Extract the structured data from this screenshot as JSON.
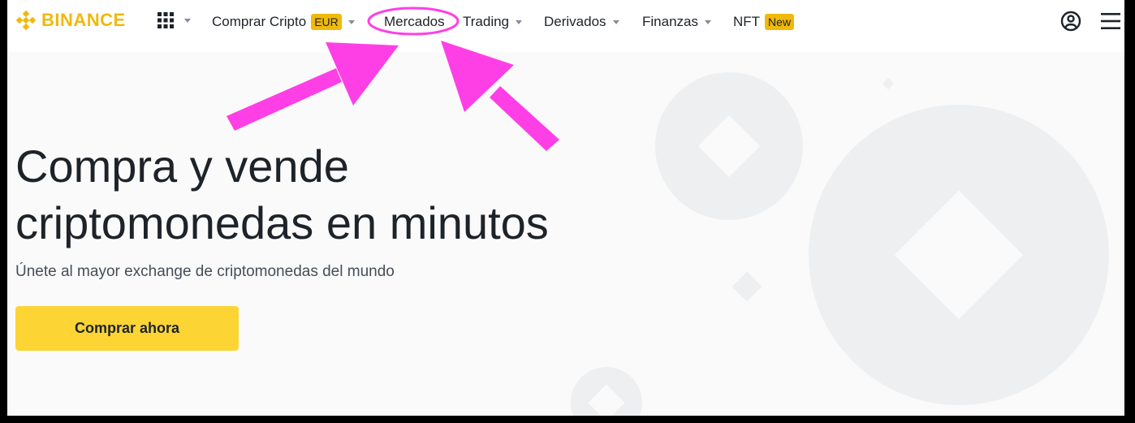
{
  "brand": {
    "name": "BINANCE",
    "color": "#F0B90B"
  },
  "nav": {
    "items": [
      {
        "label": "Comprar Cripto",
        "badge": "EUR",
        "has_caret": true
      },
      {
        "label": "Mercados",
        "badge": "",
        "has_caret": false
      },
      {
        "label": "Trading",
        "badge": "",
        "has_caret": true
      },
      {
        "label": "Derivados",
        "badge": "",
        "has_caret": true
      },
      {
        "label": "Finanzas",
        "badge": "",
        "has_caret": true
      },
      {
        "label": "NFT",
        "badge": "New",
        "has_caret": false
      }
    ],
    "icons": [
      "apps-grid-icon",
      "user-account-icon",
      "hamburger-menu-icon"
    ]
  },
  "hero": {
    "title_line1": "Compra y vende",
    "title_line2": "criptomonedas en minutos",
    "subtitle": "Únete al mayor exchange de criptomonedas del mundo",
    "cta_label": "Comprar ahora"
  },
  "colors": {
    "accent": "#F0B90B",
    "button": "#FCD535",
    "text": "#1E2329",
    "annotation": "#FF3FE6"
  }
}
